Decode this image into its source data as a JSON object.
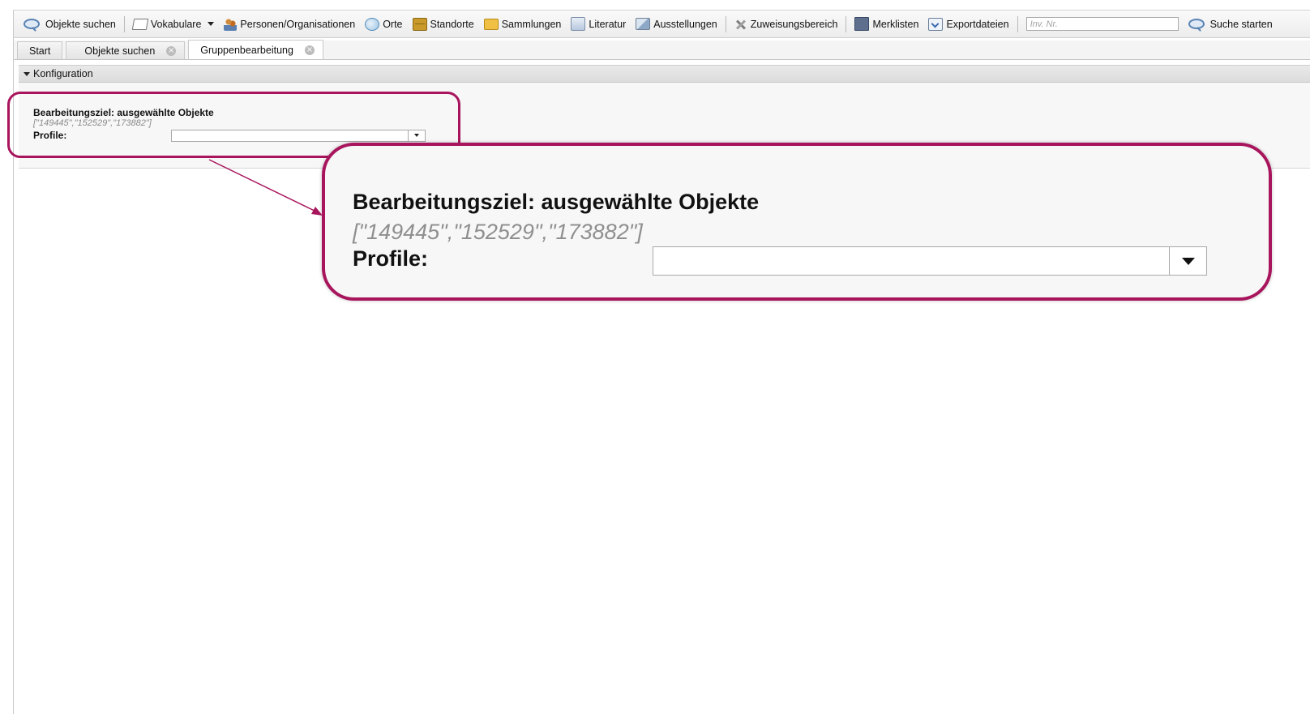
{
  "toolbar": {
    "items": [
      {
        "label": "Objekte suchen",
        "icon": "search-icon"
      },
      {
        "label": "Vokabulare",
        "icon": "book-icon",
        "dropdown": true
      },
      {
        "label": "Personen/Organisationen",
        "icon": "people-icon"
      },
      {
        "label": "Orte",
        "icon": "globe-icon"
      },
      {
        "label": "Standorte",
        "icon": "cabinet-icon"
      },
      {
        "label": "Sammlungen",
        "icon": "folder-icon"
      },
      {
        "label": "Literatur",
        "icon": "document-icon"
      },
      {
        "label": "Ausstellungen",
        "icon": "easel-icon"
      },
      {
        "label": "Zuweisungsbereich",
        "icon": "tools-icon"
      },
      {
        "label": "Merklisten",
        "icon": "list-icon"
      },
      {
        "label": "Exportdateien",
        "icon": "export-icon"
      }
    ],
    "inv_placeholder": "Inv. Nr.",
    "search_button": "Suche starten"
  },
  "tabs": [
    {
      "label": "Start",
      "closable": false,
      "active": false
    },
    {
      "label": "Objekte suchen",
      "closable": true,
      "active": false
    },
    {
      "label": "Gruppenbearbeitung",
      "closable": true,
      "active": true
    }
  ],
  "panel": {
    "header": "Konfiguration",
    "target_label": "Bearbeitungsziel: ausgewählte Objekte",
    "ids": "[\"149445\",\"152529\",\"173882\"]",
    "profile_label": "Profile:",
    "profile_value": ""
  },
  "colors": {
    "highlight": "#a8155d"
  }
}
